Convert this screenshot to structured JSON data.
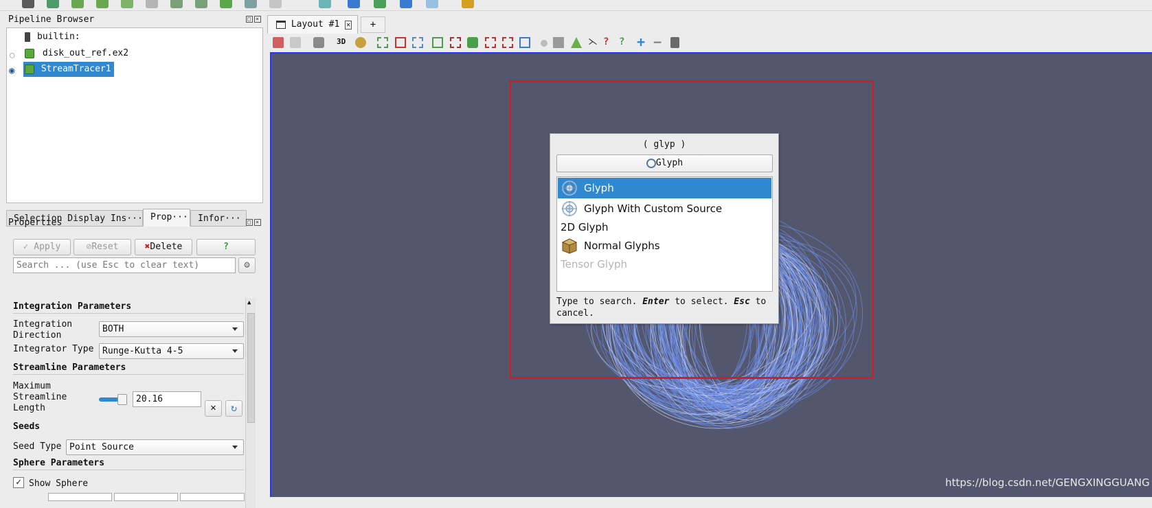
{
  "pipeline_browser": {
    "title": "Pipeline Browser",
    "items": [
      {
        "label": "builtin:"
      },
      {
        "label": "disk_out_ref.ex2"
      },
      {
        "label": "StreamTracer1"
      }
    ]
  },
  "panel_tabs": [
    {
      "label": "Selection Display Ins···"
    },
    {
      "label": "Prop···"
    },
    {
      "label": "Infor···"
    }
  ],
  "properties": {
    "title": "Properties",
    "apply_label": "Apply",
    "reset_label": "Reset",
    "delete_label": "Delete",
    "help_label": "?",
    "search_placeholder": "Search ... (use Esc to clear text)"
  },
  "integration": {
    "section_title": "Integration Parameters",
    "direction_label": "Integration Direction",
    "direction_value": "BOTH",
    "integrator_label": "Integrator Type",
    "integrator_value": "Runge-Kutta 4-5"
  },
  "streamline": {
    "section_title": "Streamline Parameters",
    "max_length_label": "Maximum Streamline Length",
    "max_length_value": "20.16",
    "slider_fraction": 0.85
  },
  "seeds": {
    "section_title": "Seeds",
    "seed_type_label": "Seed Type",
    "seed_type_value": "Point Source"
  },
  "sphere": {
    "section_title": "Sphere Parameters",
    "show_sphere_label": "Show Sphere",
    "show_sphere_checked": true
  },
  "layout_tabs": {
    "tab_label": "Layout #1",
    "add_label": "+"
  },
  "view_toolbar": {
    "mode_label": "3D"
  },
  "quick_launch": {
    "query": "( glyp )",
    "search_value": "Glyph",
    "items": [
      {
        "label": "Glyph",
        "selected": true,
        "icon": "glyph-icon"
      },
      {
        "label": "Glyph With Custom Source",
        "selected": false,
        "icon": "glyph-icon"
      },
      {
        "label": "2D Glyph",
        "selected": false,
        "icon": ""
      },
      {
        "label": "Normal Glyphs",
        "selected": false,
        "icon": "box-icon"
      },
      {
        "label": "Tensor Glyph",
        "selected": false,
        "icon": "",
        "disabled": true
      }
    ],
    "help_prefix": "Type to search. ",
    "help_enter": "Enter",
    "help_middle": " to select. ",
    "help_esc": "Esc",
    "help_suffix": " to cancel."
  },
  "watermark": "https://blog.csdn.net/GENGXINGGUANG",
  "colors": {
    "viewport_bg": "#52576e",
    "selection_blue": "#3088d0",
    "highlight_border": "#e01818",
    "streamlines": "#6f8fe8"
  }
}
